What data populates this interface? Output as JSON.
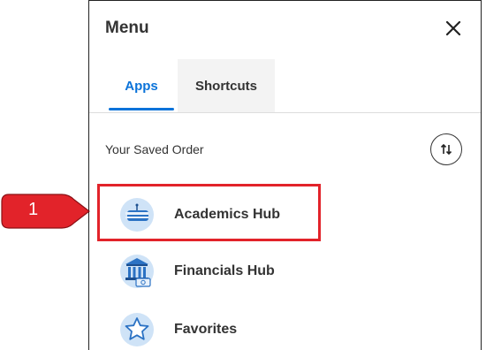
{
  "menu": {
    "title": "Menu",
    "close_icon": "close-icon"
  },
  "tabs": [
    {
      "label": "Apps",
      "active": true
    },
    {
      "label": "Shortcuts",
      "active": false
    }
  ],
  "saved_order": {
    "label": "Your Saved Order",
    "sort_icon": "sort-arrows-icon"
  },
  "apps": [
    {
      "label": "Academics Hub",
      "icon": "graduation-cap-icon"
    },
    {
      "label": "Financials Hub",
      "icon": "bank-icon"
    },
    {
      "label": "Favorites",
      "icon": "star-icon"
    }
  ],
  "callout": {
    "number": "1",
    "color": "#e2232a"
  },
  "colors": {
    "accent": "#0b73d9",
    "highlight": "#e2232a"
  }
}
